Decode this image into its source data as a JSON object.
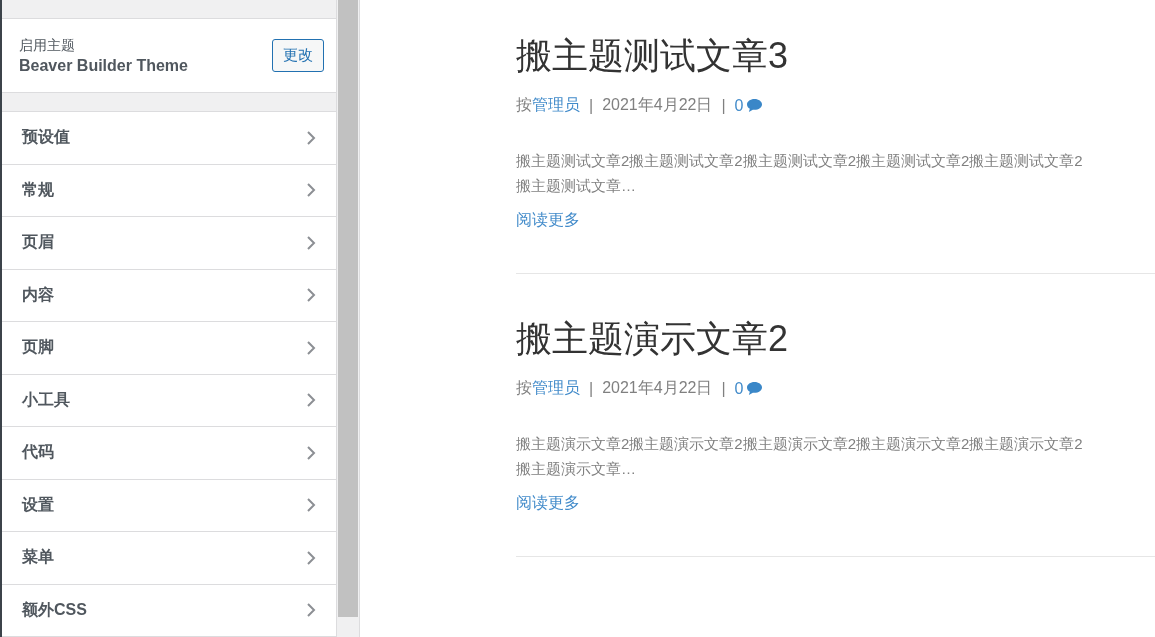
{
  "sidebar": {
    "active_theme": {
      "label": "启用主题",
      "name": "Beaver Builder Theme",
      "button": "更改"
    },
    "items": [
      {
        "label": "预设值"
      },
      {
        "label": "常规"
      },
      {
        "label": "页眉"
      },
      {
        "label": "内容"
      },
      {
        "label": "页脚"
      },
      {
        "label": "小工具"
      },
      {
        "label": "代码"
      },
      {
        "label": "设置"
      },
      {
        "label": "菜单"
      },
      {
        "label": "额外CSS"
      }
    ]
  },
  "posts": [
    {
      "title": "搬主题测试文章3",
      "meta": {
        "prefix": "按",
        "author": "管理员",
        "separator": "|",
        "date": "2021年4月22日",
        "comments": "0"
      },
      "excerpt": "搬主题测试文章2搬主题测试文章2搬主题测试文章2搬主题测试文章2搬主题测试文章2搬主题测试文章…",
      "read_more": "阅读更多"
    },
    {
      "title": "搬主题演示文章2",
      "meta": {
        "prefix": "按",
        "author": "管理员",
        "separator": "|",
        "date": "2021年4月22日",
        "comments": "0"
      },
      "excerpt": "搬主题演示文章2搬主题演示文章2搬主题演示文章2搬主题演示文章2搬主题演示文章2搬主题演示文章…",
      "read_more": "阅读更多"
    }
  ]
}
